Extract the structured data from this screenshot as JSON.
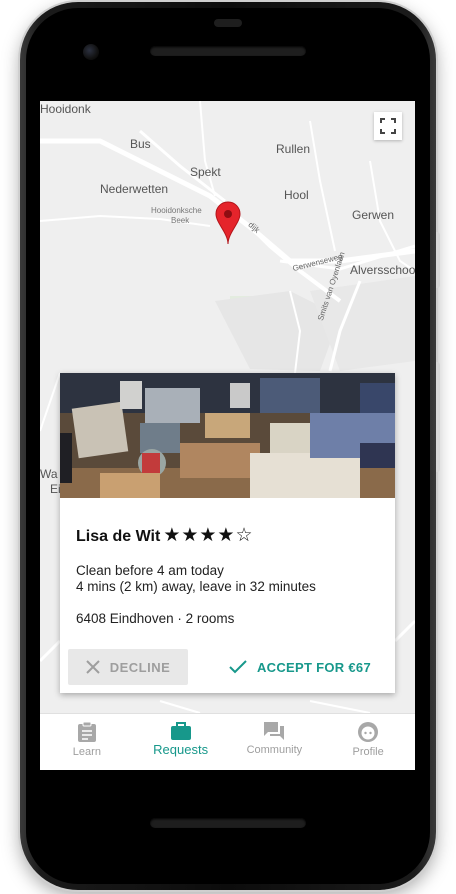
{
  "map": {
    "labels": [
      "Hooidonk",
      "Bus",
      "Spekt",
      "Rullen",
      "Nederwetten",
      "Hool",
      "Gerwen",
      "Hooidonksche",
      "Beek",
      "Alversschool",
      "Gerwenseweg",
      "Smits van Oyenlaan",
      "Wa",
      "Ei",
      "dijk"
    ]
  },
  "request": {
    "name": "Lisa de Wit",
    "rating_display": "★★★★☆",
    "rating": 4,
    "rating_max": 5,
    "line1": "Clean before 4 am today",
    "line2": "4 mins (2 km) away, leave in 32 minutes",
    "line3": "6408 Eindhoven · 2 rooms"
  },
  "actions": {
    "decline_label": "DECLINE",
    "accept_label": "ACCEPT FOR €67"
  },
  "nav": {
    "items": [
      {
        "label": "Learn",
        "icon": "clipboard-icon",
        "active": false
      },
      {
        "label": "Requests",
        "icon": "briefcase-icon",
        "active": true
      },
      {
        "label": "Community",
        "icon": "forum-icon",
        "active": false
      },
      {
        "label": "Profile",
        "icon": "face-icon",
        "active": false
      }
    ]
  },
  "colors": {
    "accent": "#17988b",
    "pin": "#e5242b",
    "inactive": "#9e9e9e"
  }
}
